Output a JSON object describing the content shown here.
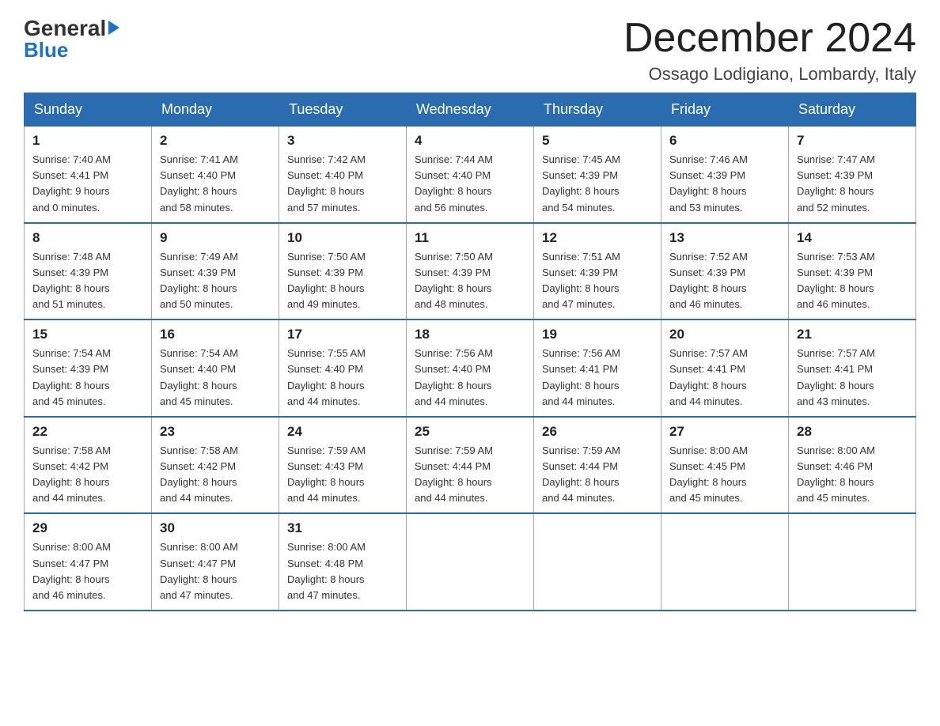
{
  "header": {
    "title": "December 2024",
    "location": "Ossago Lodigiano, Lombardy, Italy",
    "logo_general": "General",
    "logo_blue": "Blue"
  },
  "days_of_week": [
    "Sunday",
    "Monday",
    "Tuesday",
    "Wednesday",
    "Thursday",
    "Friday",
    "Saturday"
  ],
  "weeks": [
    [
      {
        "day": "1",
        "sunrise": "7:40 AM",
        "sunset": "4:41 PM",
        "daylight": "9 hours and 0 minutes."
      },
      {
        "day": "2",
        "sunrise": "7:41 AM",
        "sunset": "4:40 PM",
        "daylight": "8 hours and 58 minutes."
      },
      {
        "day": "3",
        "sunrise": "7:42 AM",
        "sunset": "4:40 PM",
        "daylight": "8 hours and 57 minutes."
      },
      {
        "day": "4",
        "sunrise": "7:44 AM",
        "sunset": "4:40 PM",
        "daylight": "8 hours and 56 minutes."
      },
      {
        "day": "5",
        "sunrise": "7:45 AM",
        "sunset": "4:39 PM",
        "daylight": "8 hours and 54 minutes."
      },
      {
        "day": "6",
        "sunrise": "7:46 AM",
        "sunset": "4:39 PM",
        "daylight": "8 hours and 53 minutes."
      },
      {
        "day": "7",
        "sunrise": "7:47 AM",
        "sunset": "4:39 PM",
        "daylight": "8 hours and 52 minutes."
      }
    ],
    [
      {
        "day": "8",
        "sunrise": "7:48 AM",
        "sunset": "4:39 PM",
        "daylight": "8 hours and 51 minutes."
      },
      {
        "day": "9",
        "sunrise": "7:49 AM",
        "sunset": "4:39 PM",
        "daylight": "8 hours and 50 minutes."
      },
      {
        "day": "10",
        "sunrise": "7:50 AM",
        "sunset": "4:39 PM",
        "daylight": "8 hours and 49 minutes."
      },
      {
        "day": "11",
        "sunrise": "7:50 AM",
        "sunset": "4:39 PM",
        "daylight": "8 hours and 48 minutes."
      },
      {
        "day": "12",
        "sunrise": "7:51 AM",
        "sunset": "4:39 PM",
        "daylight": "8 hours and 47 minutes."
      },
      {
        "day": "13",
        "sunrise": "7:52 AM",
        "sunset": "4:39 PM",
        "daylight": "8 hours and 46 minutes."
      },
      {
        "day": "14",
        "sunrise": "7:53 AM",
        "sunset": "4:39 PM",
        "daylight": "8 hours and 46 minutes."
      }
    ],
    [
      {
        "day": "15",
        "sunrise": "7:54 AM",
        "sunset": "4:39 PM",
        "daylight": "8 hours and 45 minutes."
      },
      {
        "day": "16",
        "sunrise": "7:54 AM",
        "sunset": "4:40 PM",
        "daylight": "8 hours and 45 minutes."
      },
      {
        "day": "17",
        "sunrise": "7:55 AM",
        "sunset": "4:40 PM",
        "daylight": "8 hours and 44 minutes."
      },
      {
        "day": "18",
        "sunrise": "7:56 AM",
        "sunset": "4:40 PM",
        "daylight": "8 hours and 44 minutes."
      },
      {
        "day": "19",
        "sunrise": "7:56 AM",
        "sunset": "4:41 PM",
        "daylight": "8 hours and 44 minutes."
      },
      {
        "day": "20",
        "sunrise": "7:57 AM",
        "sunset": "4:41 PM",
        "daylight": "8 hours and 44 minutes."
      },
      {
        "day": "21",
        "sunrise": "7:57 AM",
        "sunset": "4:41 PM",
        "daylight": "8 hours and 43 minutes."
      }
    ],
    [
      {
        "day": "22",
        "sunrise": "7:58 AM",
        "sunset": "4:42 PM",
        "daylight": "8 hours and 44 minutes."
      },
      {
        "day": "23",
        "sunrise": "7:58 AM",
        "sunset": "4:42 PM",
        "daylight": "8 hours and 44 minutes."
      },
      {
        "day": "24",
        "sunrise": "7:59 AM",
        "sunset": "4:43 PM",
        "daylight": "8 hours and 44 minutes."
      },
      {
        "day": "25",
        "sunrise": "7:59 AM",
        "sunset": "4:44 PM",
        "daylight": "8 hours and 44 minutes."
      },
      {
        "day": "26",
        "sunrise": "7:59 AM",
        "sunset": "4:44 PM",
        "daylight": "8 hours and 44 minutes."
      },
      {
        "day": "27",
        "sunrise": "8:00 AM",
        "sunset": "4:45 PM",
        "daylight": "8 hours and 45 minutes."
      },
      {
        "day": "28",
        "sunrise": "8:00 AM",
        "sunset": "4:46 PM",
        "daylight": "8 hours and 45 minutes."
      }
    ],
    [
      {
        "day": "29",
        "sunrise": "8:00 AM",
        "sunset": "4:47 PM",
        "daylight": "8 hours and 46 minutes."
      },
      {
        "day": "30",
        "sunrise": "8:00 AM",
        "sunset": "4:47 PM",
        "daylight": "8 hours and 47 minutes."
      },
      {
        "day": "31",
        "sunrise": "8:00 AM",
        "sunset": "4:48 PM",
        "daylight": "8 hours and 47 minutes."
      },
      null,
      null,
      null,
      null
    ]
  ],
  "labels": {
    "sunrise": "Sunrise:",
    "sunset": "Sunset:",
    "daylight": "Daylight:"
  }
}
